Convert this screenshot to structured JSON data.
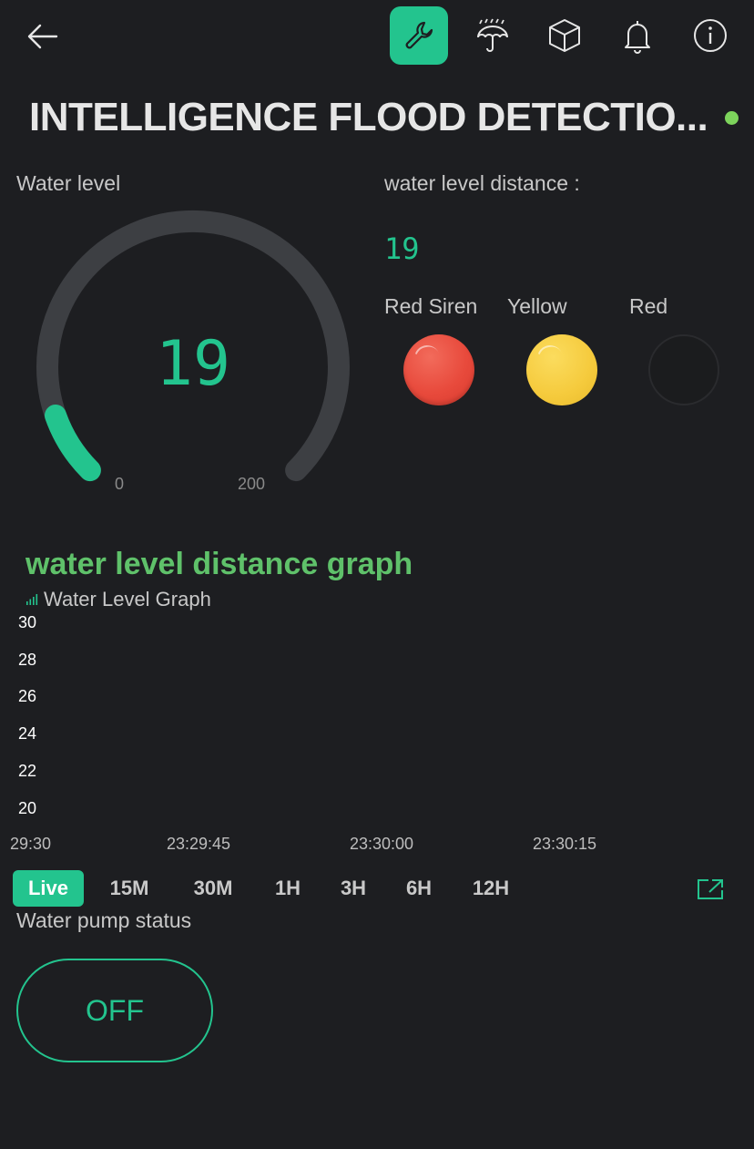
{
  "colors": {
    "background": "#1d1e21",
    "accent": "#23c48e",
    "online": "#7dd45c",
    "graph_title": "#5fc16a",
    "led_red": "#e84a3c",
    "led_yellow": "#f5ca3c"
  },
  "header": {
    "icons": [
      "back-arrow-icon",
      "wrench-icon",
      "rain-umbrella-icon",
      "cube-icon",
      "bell-icon",
      "info-icon"
    ],
    "title": "INTELLIGENCE FLOOD DETECTIO...",
    "status": "online"
  },
  "gauge": {
    "label": "Water level",
    "value": "19",
    "min": "0",
    "max": "200",
    "fraction": 0.095
  },
  "distance": {
    "label": "water level distance :",
    "value": "19"
  },
  "leds": [
    {
      "label": "Red Siren",
      "state": "on",
      "color": "#e84a3c"
    },
    {
      "label": "Yellow",
      "state": "on",
      "color": "#f5ca3c"
    },
    {
      "label": "Red",
      "state": "off",
      "color": "#1b1c1e"
    }
  ],
  "graph": {
    "title": "water level distance graph",
    "subtitle": "Water Level Graph",
    "y_ticks": [
      "30",
      "28",
      "26",
      "24",
      "22",
      "20"
    ],
    "x_ticks": [
      "29:30",
      "23:29:45",
      "23:30:00",
      "23:30:15"
    ],
    "ranges": [
      "Live",
      "15M",
      "30M",
      "1H",
      "3H",
      "6H",
      "12H"
    ],
    "active_range": "Live"
  },
  "chart_data": {
    "type": "line",
    "title": "Water Level Graph",
    "ylim": [
      20,
      30
    ],
    "y_ticks": [
      30,
      28,
      26,
      24,
      22,
      20
    ],
    "x_ticks": [
      "29:30",
      "23:29:45",
      "23:30:00",
      "23:30:15"
    ],
    "series": []
  },
  "pump": {
    "label": "Water pump status",
    "button": "OFF"
  }
}
